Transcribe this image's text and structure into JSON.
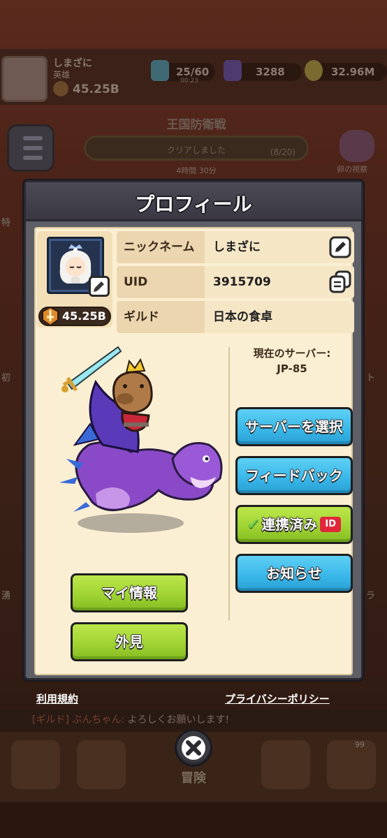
{
  "background": {
    "player_name": "しまざに",
    "player_rank": "英雄",
    "player_power": "45.25B",
    "energy": "25/60",
    "energy_timer": "00:23",
    "gems": "3288",
    "gold": "32.96M",
    "event_title": "王国防衛戦",
    "event_status": "クリアしました",
    "event_count": "(8/20)",
    "event_timer": "4時間 30分",
    "egg_label": "卵の視察",
    "chat_guild_tag": "[ギルド] ぶんちゃん:",
    "chat_message": "よろしくお願いします!",
    "nav_center_label": "冒険",
    "nav_badge_count": "99",
    "side_fragments": [
      "特",
      "初",
      "ト",
      "湧",
      "ラ"
    ]
  },
  "modal": {
    "title": "プロフィール",
    "power": "45.25B",
    "rows": [
      {
        "label": "ニックネーム",
        "value": "しまざに",
        "action_icon": "edit-icon"
      },
      {
        "label": "UID",
        "value": "3915709",
        "action_icon": "copy-icon"
      },
      {
        "label": "ギルド",
        "value": "日本の食卓",
        "action_icon": ""
      }
    ],
    "server_label": "現在のサーバー:",
    "server_value": "JP-85",
    "buttons": {
      "select_server": "サーバーを選択",
      "feedback": "フィードバック",
      "linked": "連携済み",
      "linked_badge": "ID",
      "notice": "お知らせ",
      "my_info": "マイ情報",
      "appearance": "外見"
    }
  },
  "links": {
    "terms": "利用規約",
    "privacy": "プライバシーポリシー"
  },
  "colors": {
    "modal_body": "#fbefd3",
    "button_blue": "#38b6e8",
    "button_green": "#9ed232",
    "id_badge": "#e0283a"
  }
}
